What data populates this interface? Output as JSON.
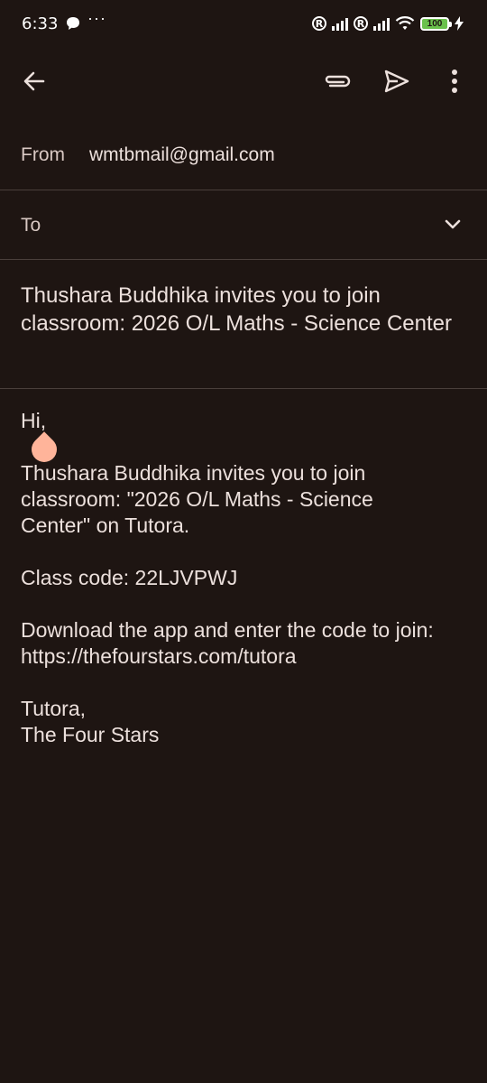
{
  "status_bar": {
    "time": "6:33",
    "dots": "···",
    "roaming_1": "R",
    "roaming_2": "R",
    "battery_level": "100"
  },
  "app_bar": {
    "back_icon": "arrow-left-icon",
    "attach_icon": "paperclip-icon",
    "send_icon": "send-icon",
    "more_icon": "more-vert-icon"
  },
  "compose": {
    "from_label": "From",
    "from_value": "wmtbmail@gmail.com",
    "to_label": "To",
    "subject": "Thushara Buddhika invites you to join classroom: 2026 O/L Maths - Science Center",
    "body": {
      "greeting": "Hi,",
      "invite_line1": "Thushara Buddhika invites you to join",
      "invite_line2": "classroom: \"2026 O/L Maths - Science",
      "invite_line3": "Center\" on Tutora.",
      "class_code": "Class code: 22LJVPWJ",
      "download_line": "Download the app and enter the code to join:",
      "link": "https://thefourstars.com/tutora",
      "sign1": "Tutora,",
      "sign2": "The Four Stars"
    }
  },
  "colors": {
    "background": "#1e1512",
    "text": "#ece0dc",
    "divider": "#4a3f3b",
    "cursor_handle": "#ffb49a",
    "battery": "#6ac14c"
  }
}
